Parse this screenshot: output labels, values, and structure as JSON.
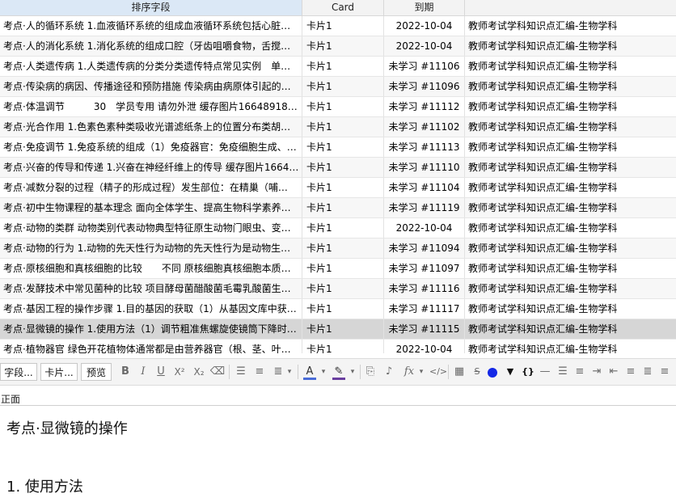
{
  "columns": {
    "sort_field": "排序字段",
    "card": "Card",
    "due": "到期",
    "deck": ""
  },
  "rows": [
    {
      "sort": "考点·人的循环系统 1.血液循环系统的组成血液循环系统包括心脏…",
      "card": "卡片1",
      "due": "2022-10-04",
      "deck": "教师考试学科知识点汇编-生物学科"
    },
    {
      "sort": "考点·人的消化系统 1.消化系统的组成口腔（牙齿咀嚼食物，舌搅…",
      "card": "卡片1",
      "due": "2022-10-04",
      "deck": "教师考试学科知识点汇编-生物学科"
    },
    {
      "sort": "考点·人类遗传病 1.人类遗传病的分类分类遗传特点常见实例　单…",
      "card": "卡片1",
      "due": "未学习 #11106",
      "deck": "教师考试学科知识点汇编-生物学科"
    },
    {
      "sort": "考点·传染病的病因、传播途径和预防措施 传染病由病原体引起的…",
      "card": "卡片1",
      "due": "未学习 #11096",
      "deck": "教师考试学科知识点汇编-生物学科"
    },
    {
      "sort": "考点·体温调节　　　30　学员专用 请勿外泄 缓存图片16648918…",
      "card": "卡片1",
      "due": "未学习 #11112",
      "deck": "教师考试学科知识点汇编-生物学科"
    },
    {
      "sort": "考点·光合作用 1.色素色素种类吸收光谱滤纸条上的位置分布类胡…",
      "card": "卡片1",
      "due": "未学习 #11102",
      "deck": "教师考试学科知识点汇编-生物学科"
    },
    {
      "sort": "考点·免疫调节 1.免疫系统的组成（1）免疫器官：免疫细胞生成、…",
      "card": "卡片1",
      "due": "未学习 #11113",
      "deck": "教师考试学科知识点汇编-生物学科"
    },
    {
      "sort": "考点·兴奋的传导和传递 1.兴奋在神经纤维上的传导 缓存图片1664…",
      "card": "卡片1",
      "due": "未学习 #11110",
      "deck": "教师考试学科知识点汇编-生物学科"
    },
    {
      "sort": "考点·减数分裂的过程（精子的形成过程）发生部位：在精巢（哺…",
      "card": "卡片1",
      "due": "未学习 #11104",
      "deck": "教师考试学科知识点汇编-生物学科"
    },
    {
      "sort": "考点·初中生物课程的基本理念 面向全体学生、提高生物科学素养…",
      "card": "卡片1",
      "due": "未学习 #11119",
      "deck": "教师考试学科知识点汇编-生物学科"
    },
    {
      "sort": "考点·动物的类群 动物类别代表动物典型特征原生动物门眼虫、变…",
      "card": "卡片1",
      "due": "2022-10-04",
      "deck": "教师考试学科知识点汇编-生物学科"
    },
    {
      "sort": "考点·动物的行为 1.动物的先天性行为动物的先天性行为是动物生…",
      "card": "卡片1",
      "due": "未学习 #11094",
      "deck": "教师考试学科知识点汇编-生物学科"
    },
    {
      "sort": "考点·原核细胞和真核细胞的比较　　不同 原核细胞真核细胞本质…",
      "card": "卡片1",
      "due": "未学习 #11097",
      "deck": "教师考试学科知识点汇编-生物学科"
    },
    {
      "sort": "考点·发酵技术中常见菌种的比较 项目酵母菌醋酸菌毛霉乳酸菌生…",
      "card": "卡片1",
      "due": "未学习 #11116",
      "deck": "教师考试学科知识点汇编-生物学科"
    },
    {
      "sort": "考点·基因工程的操作步骤 1.目的基因的获取（1）从基因文库中获…",
      "card": "卡片1",
      "due": "未学习 #11117",
      "deck": "教师考试学科知识点汇编-生物学科"
    },
    {
      "sort": "考点·显微镜的操作 1.使用方法（1）调节粗准焦螺旋使镜筒下降时…",
      "card": "卡片1",
      "due": "未学习 #11115",
      "deck": "教师考试学科知识点汇编-生物学科"
    },
    {
      "sort": "考点·植物器官 绿色开花植物体通常都是由营养器官（根、茎、叶…",
      "card": "卡片1",
      "due": "2022-10-04",
      "deck": "教师考试学科知识点汇编-生物学科"
    }
  ],
  "selected_row": 15,
  "toolbar": {
    "fields_button": "字段...",
    "cards_button": "卡片...",
    "preview_button": "预览"
  },
  "editor": {
    "field_label": "正面",
    "line1": "考点·显微镜的操作",
    "line2": "1. 使用方法"
  },
  "colors": {
    "selected_row": "#d6d6d6",
    "text_color_swatch": "#4a6cd8",
    "highlight_swatch": "#6a3fa0",
    "blue_circle": "#1428e6"
  }
}
